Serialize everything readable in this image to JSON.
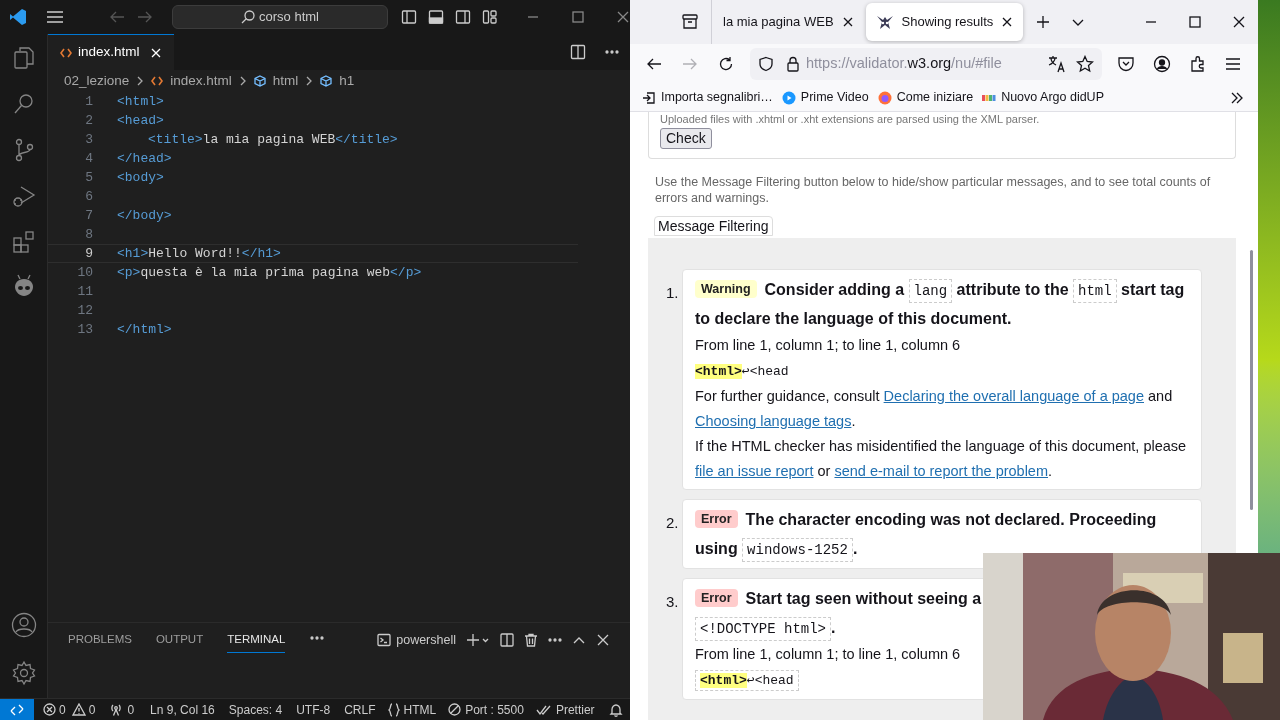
{
  "editor": {
    "search": "corso html",
    "tabs": [
      {
        "label": "index.html",
        "selected": true
      }
    ],
    "breadcrumbs": [
      {
        "label": "02_lezione",
        "kind": "folder"
      },
      {
        "label": "index.html",
        "kind": "file"
      },
      {
        "label": "html",
        "kind": "symbol"
      },
      {
        "label": "h1",
        "kind": "symbol"
      }
    ],
    "lines": [
      {
        "number": "1",
        "current": false,
        "indented": false,
        "segments": [
          {
            "kind": "tag",
            "text": "<html>"
          }
        ]
      },
      {
        "number": "2",
        "current": false,
        "indented": false,
        "segments": [
          {
            "kind": "tag",
            "text": "<head>"
          }
        ]
      },
      {
        "number": "3",
        "current": false,
        "indented": true,
        "segments": [
          {
            "kind": "tag",
            "text": "<title>"
          },
          {
            "kind": "text",
            "text": "la mia pagina WEB"
          },
          {
            "kind": "tag",
            "text": "</title>"
          }
        ]
      },
      {
        "number": "4",
        "current": false,
        "indented": false,
        "segments": [
          {
            "kind": "tag",
            "text": "</head>"
          }
        ]
      },
      {
        "number": "5",
        "current": false,
        "indented": false,
        "segments": [
          {
            "kind": "tag",
            "text": "<body>"
          }
        ]
      },
      {
        "number": "6",
        "current": false
      },
      {
        "number": "7",
        "current": false,
        "indented": false,
        "segments": [
          {
            "kind": "tag",
            "text": "</body>"
          }
        ]
      },
      {
        "number": "8",
        "current": false
      },
      {
        "number": "9",
        "current": true,
        "indented": false,
        "segments": [
          {
            "kind": "tag",
            "text": "<h1>"
          },
          {
            "kind": "text",
            "text": "Hello Word!!"
          },
          {
            "kind": "tag",
            "text": "</h1>"
          }
        ]
      },
      {
        "number": "10",
        "current": false,
        "indented": false,
        "segments": [
          {
            "kind": "tag",
            "text": "<p>"
          },
          {
            "kind": "text",
            "text": "questa è la mia prima pagina web"
          },
          {
            "kind": "tag",
            "text": "</p>"
          }
        ]
      },
      {
        "number": "11",
        "current": false
      },
      {
        "number": "12",
        "current": false
      },
      {
        "number": "13",
        "current": false,
        "indented": false,
        "segments": [
          {
            "kind": "tag",
            "text": "</html>"
          }
        ]
      }
    ],
    "panel_tabs": [
      {
        "label": "PROBLEMS",
        "selected": false
      },
      {
        "label": "OUTPUT",
        "selected": false
      },
      {
        "label": "TERMINAL",
        "selected": true
      }
    ],
    "terminal": "powershell",
    "status_bar": {
      "errors": "0",
      "warnings": "0",
      "ports": "0",
      "position": "Ln 9, Col 16",
      "indent": "Spaces: 4",
      "encoding": "UTF-8",
      "eol": "CRLF",
      "language": "HTML",
      "live_server": "Port : 5500",
      "formatter": "Prettier"
    }
  },
  "browser": {
    "tabs": [
      {
        "title": "la mia pagina WEB",
        "selected": false
      },
      {
        "title": "Showing results",
        "selected": true
      }
    ],
    "url": {
      "prefix": "https://validator.",
      "domain": "w3.org",
      "path": "/nu/#file"
    },
    "bookmarks": [
      {
        "label": "Importa segnalibri…",
        "kind": "import"
      },
      {
        "label": "Prime Video",
        "kind": "video"
      },
      {
        "label": "Come iniziare",
        "kind": "firefox"
      },
      {
        "label": "Nuovo Argo didUP",
        "kind": "argo"
      }
    ],
    "page": {
      "upload_note": "Uploaded files with .xhtml or .xht extensions are parsed using the XML parser.",
      "check_button": "Check",
      "filter_note": "Use the Message Filtering button below to hide/show particular messages, and to see total counts of errors and warnings.",
      "filter_button": "Message Filtering",
      "messages": [
        {
          "number": "1.",
          "kind": "warning",
          "label": "Warning",
          "title": [
            {
              "kind": "text",
              "text": "Consider adding a "
            },
            {
              "kind": "code",
              "text": "lang"
            },
            {
              "kind": "text",
              "text": " attribute to the "
            },
            {
              "kind": "code",
              "text": "html"
            },
            {
              "kind": "text",
              "text": " start tag to declare the language of this document."
            }
          ],
          "details": [
            {
              "kind": "location",
              "text": "From line 1, column 1; to line 1, column 6"
            },
            {
              "kind": "extract",
              "outlined": false,
              "segments": [
                {
                  "kind": "highlight",
                  "text": "<html>"
                },
                {
                  "kind": "plain",
                  "text": "↩<head"
                }
              ]
            },
            {
              "kind": "paragraph",
              "segments": [
                {
                  "kind": "text",
                  "text": "For further guidance, consult "
                },
                {
                  "kind": "link",
                  "text": "Declaring the overall language of a page"
                },
                {
                  "kind": "text",
                  "text": " and "
                },
                {
                  "kind": "link",
                  "text": "Choosing language tags"
                },
                {
                  "kind": "text",
                  "text": "."
                }
              ]
            },
            {
              "kind": "paragraph",
              "segments": [
                {
                  "kind": "text",
                  "text": "If the HTML checker has misidentified the language of this document, please "
                },
                {
                  "kind": "link",
                  "text": "file an issue report"
                },
                {
                  "kind": "text",
                  "text": " or "
                },
                {
                  "kind": "link",
                  "text": "send e-mail to report the problem"
                },
                {
                  "kind": "text",
                  "text": "."
                }
              ]
            }
          ]
        },
        {
          "number": "2.",
          "kind": "error",
          "label": "Error",
          "title": [
            {
              "kind": "text",
              "text": "The character encoding was not declared. Proceeding using "
            },
            {
              "kind": "code",
              "text": "windows-1252"
            },
            {
              "kind": "text",
              "text": "."
            }
          ]
        },
        {
          "number": "3.",
          "kind": "error",
          "label": "Error",
          "title": [
            {
              "kind": "text",
              "text": "Start tag seen without seeing a "
            },
            {
              "kind": "code_on_new_line",
              "text": "<!DOCTYPE html>"
            },
            {
              "kind": "text",
              "text": "."
            }
          ],
          "details": [
            {
              "kind": "location",
              "text": "From line 1, column 1; to line 1, column 6"
            },
            {
              "kind": "extract",
              "outlined": true,
              "segments": [
                {
                  "kind": "highlight",
                  "text": "<html>"
                },
                {
                  "kind": "plain",
                  "text": "↩<head"
                }
              ]
            }
          ]
        }
      ]
    }
  }
}
